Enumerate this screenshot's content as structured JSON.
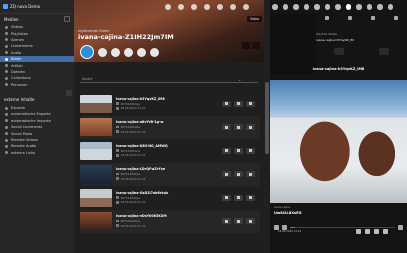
{
  "brand": {
    "name": "ZQ nova Demo"
  },
  "sidebar": {
    "section_title": "Medien",
    "items": [
      {
        "label": "Videos",
        "active": false
      },
      {
        "label": "Playlisten",
        "active": false
      },
      {
        "label": "Szenen",
        "active": false
      },
      {
        "label": "Livestreams",
        "active": false
      },
      {
        "label": "Audio",
        "active": false
      },
      {
        "label": "Bilder",
        "active": true
      },
      {
        "label": "Artikel",
        "active": false
      },
      {
        "label": "Dateien",
        "active": false
      },
      {
        "label": "Collections",
        "active": false
      },
      {
        "label": "Personen",
        "active": false
      }
    ],
    "section2_title": "externe Inhalte",
    "items2": [
      {
        "label": "Exporte"
      },
      {
        "label": "automatische Exporte"
      },
      {
        "label": "automatische Importe"
      },
      {
        "label": "Social Comments"
      },
      {
        "label": "Social Posts"
      },
      {
        "label": "Remote Videos"
      },
      {
        "label": "Remote Audio"
      },
      {
        "label": "externe Links"
      }
    ]
  },
  "detail": {
    "subtitle": "ergänzende Daten",
    "title": "ivana-cajina-Z1IH22Jm7IM",
    "video_badge": "Video",
    "search_label": "Suche"
  },
  "list": [
    {
      "name": "ivana-cajina-h3YqvKZ_IM8",
      "id": "907544994ya",
      "date": "18.06.2020 12:41"
    },
    {
      "name": "ivana-cajina-a8vYrB-1g-w",
      "id": "9075449990a",
      "date": "18.06.2020 12:41"
    },
    {
      "name": "ivana-cajina-K8ll-NG_AMWQ",
      "id": "907544994oa",
      "date": "18.06.2020 12:41"
    },
    {
      "name": "ivana-cajina-LDrQFwZrYxe",
      "id": "907544994ya",
      "date": "18.06.2020 12:41"
    },
    {
      "name": "ivana-cajina-GsD2l7ab6rkuk",
      "id": "907544994ya",
      "date": "18.06.2020 12:41"
    },
    {
      "name": "ivana-cajina-vDsY0063KXM",
      "id": "907544994ya",
      "date": "18.06.2020 12:41"
    }
  ],
  "preview": {
    "small_label": "Ähnliche Inhalte",
    "small_title": "ivana-cajina-h3YqvKZ_IM",
    "title": "ivana-cajina-h3YqvKZ_IM8",
    "caption_small": "ivana-cajina-",
    "caption": "Uw8i2L8XsEG",
    "date": "18.06.2020 12:41",
    "progress_fraction": 0.05
  },
  "colors": {
    "accent": "#2d8fd6",
    "active_nav": "#3f6fa3"
  }
}
